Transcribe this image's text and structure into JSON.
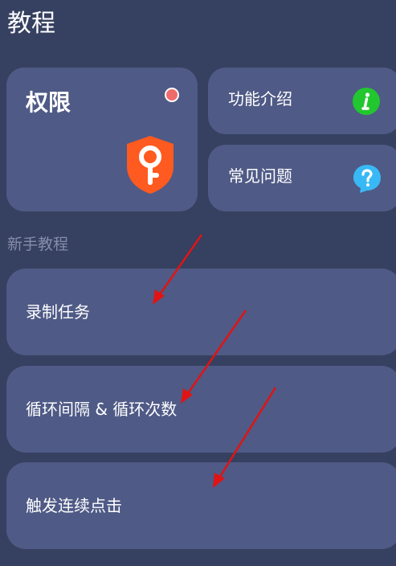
{
  "header": {
    "title": "教程"
  },
  "permissions_card": {
    "title": "权限",
    "dot_color": "#f06a6a",
    "icon": "shield-key-icon",
    "icon_color": "#ff5a1f"
  },
  "feature_card": {
    "label": "功能介绍",
    "icon": "info-icon",
    "icon_color": "#22c72f"
  },
  "faq_card": {
    "label": "常见问题",
    "icon": "help-bubble-icon",
    "icon_color": "#38b9f5"
  },
  "section": {
    "title": "新手教程"
  },
  "tutorials": [
    {
      "label": "录制任务"
    },
    {
      "label": "循环间隔 & 循环次数"
    },
    {
      "label": "触发连续点击"
    }
  ],
  "colors": {
    "background": "#364060",
    "card": "#4f5a86",
    "muted_text": "#858dab",
    "annotation_arrow": "#e01414"
  }
}
